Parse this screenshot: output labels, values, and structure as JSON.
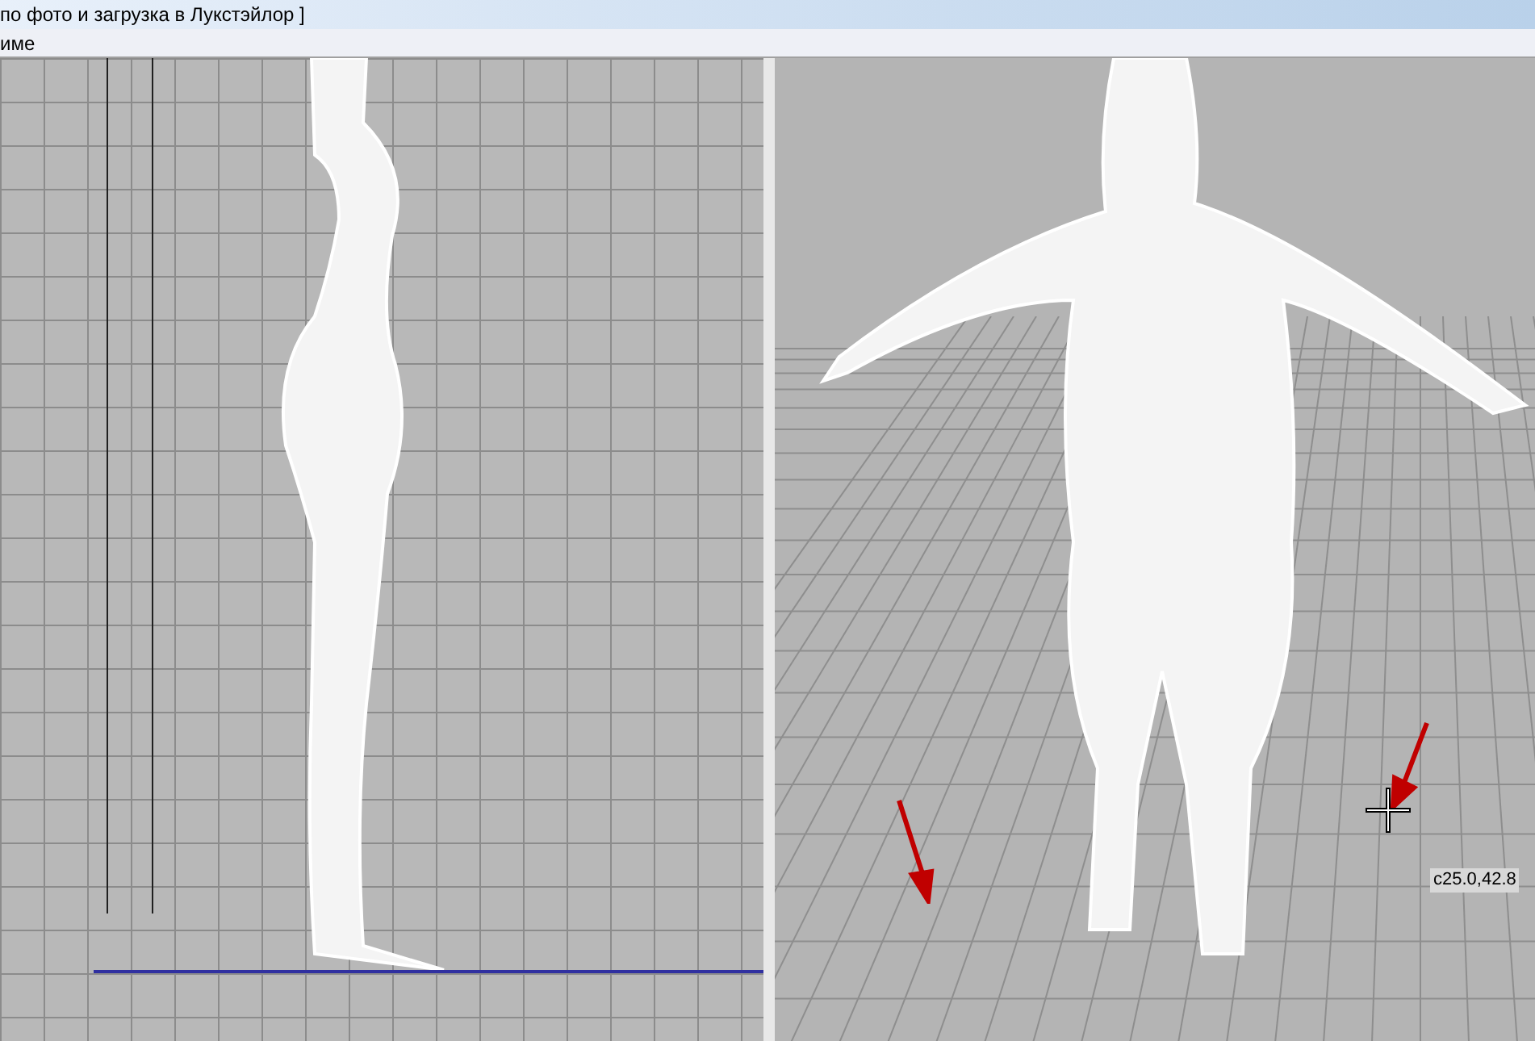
{
  "window": {
    "title": "по фото и загрузка в Лукстэйлор ]"
  },
  "menu_bar": {
    "items": [
      "име"
    ]
  },
  "viewports": {
    "perspective": {
      "cursor_readout": "c25.0,42.8"
    }
  }
}
